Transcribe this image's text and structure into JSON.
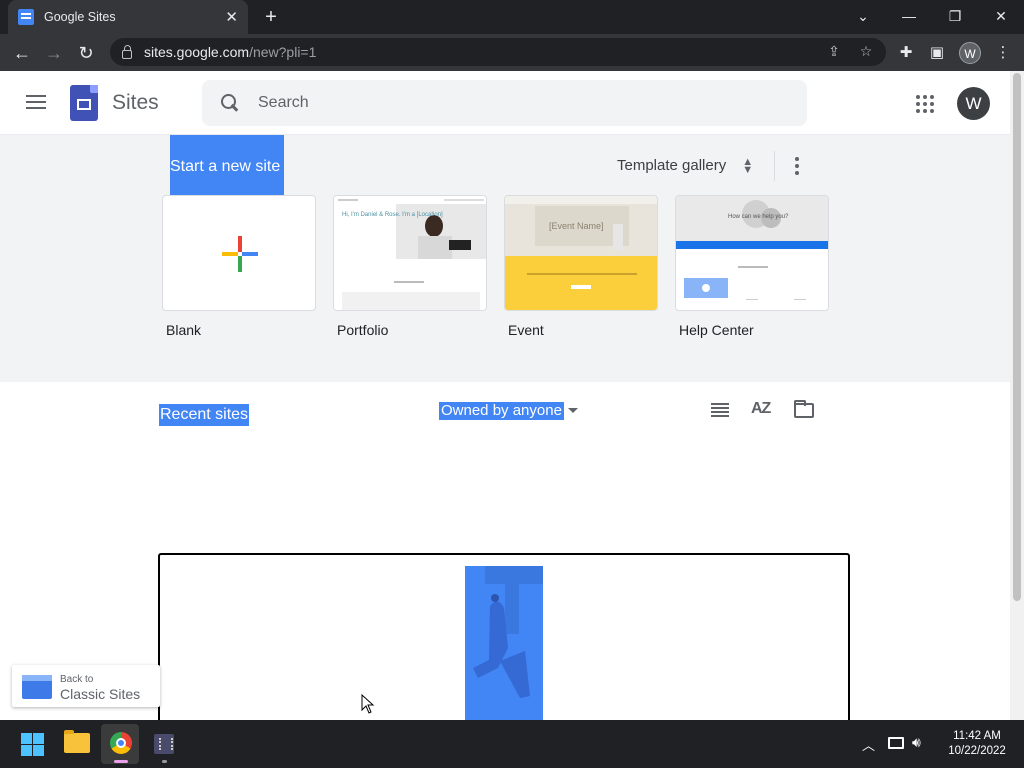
{
  "browser": {
    "tab_title": "Google Sites",
    "url_host": "sites.google.com",
    "url_path": "/new?pli=1",
    "profile_initial": "W"
  },
  "header": {
    "app_title": "Sites",
    "search_placeholder": "Search",
    "avatar_initial": "W"
  },
  "templates": {
    "start_new_label": "Start a new site",
    "gallery_label": "Template gallery",
    "items": [
      {
        "label": "Blank"
      },
      {
        "label": "Portfolio"
      },
      {
        "label": "Event"
      },
      {
        "label": "Help Center"
      }
    ],
    "portfolio_heading": "Hi, I'm Daniel & Rose. I'm a [Location]",
    "event_heading": "[Event Name]",
    "helpcenter_heading": "How can we help you?"
  },
  "recent": {
    "title": "Recent sites",
    "filter_label": "Owned by anyone",
    "sort_label": "AZ"
  },
  "back_classic": {
    "small": "Back to",
    "big": "Classic Sites"
  },
  "taskbar": {
    "time": "11:42 AM",
    "date": "10/22/2022"
  },
  "colors": {
    "accent": "#4285f4",
    "chrome_dark": "#202124",
    "toolbar": "#35363a",
    "template_bg": "#f1f3f4"
  }
}
